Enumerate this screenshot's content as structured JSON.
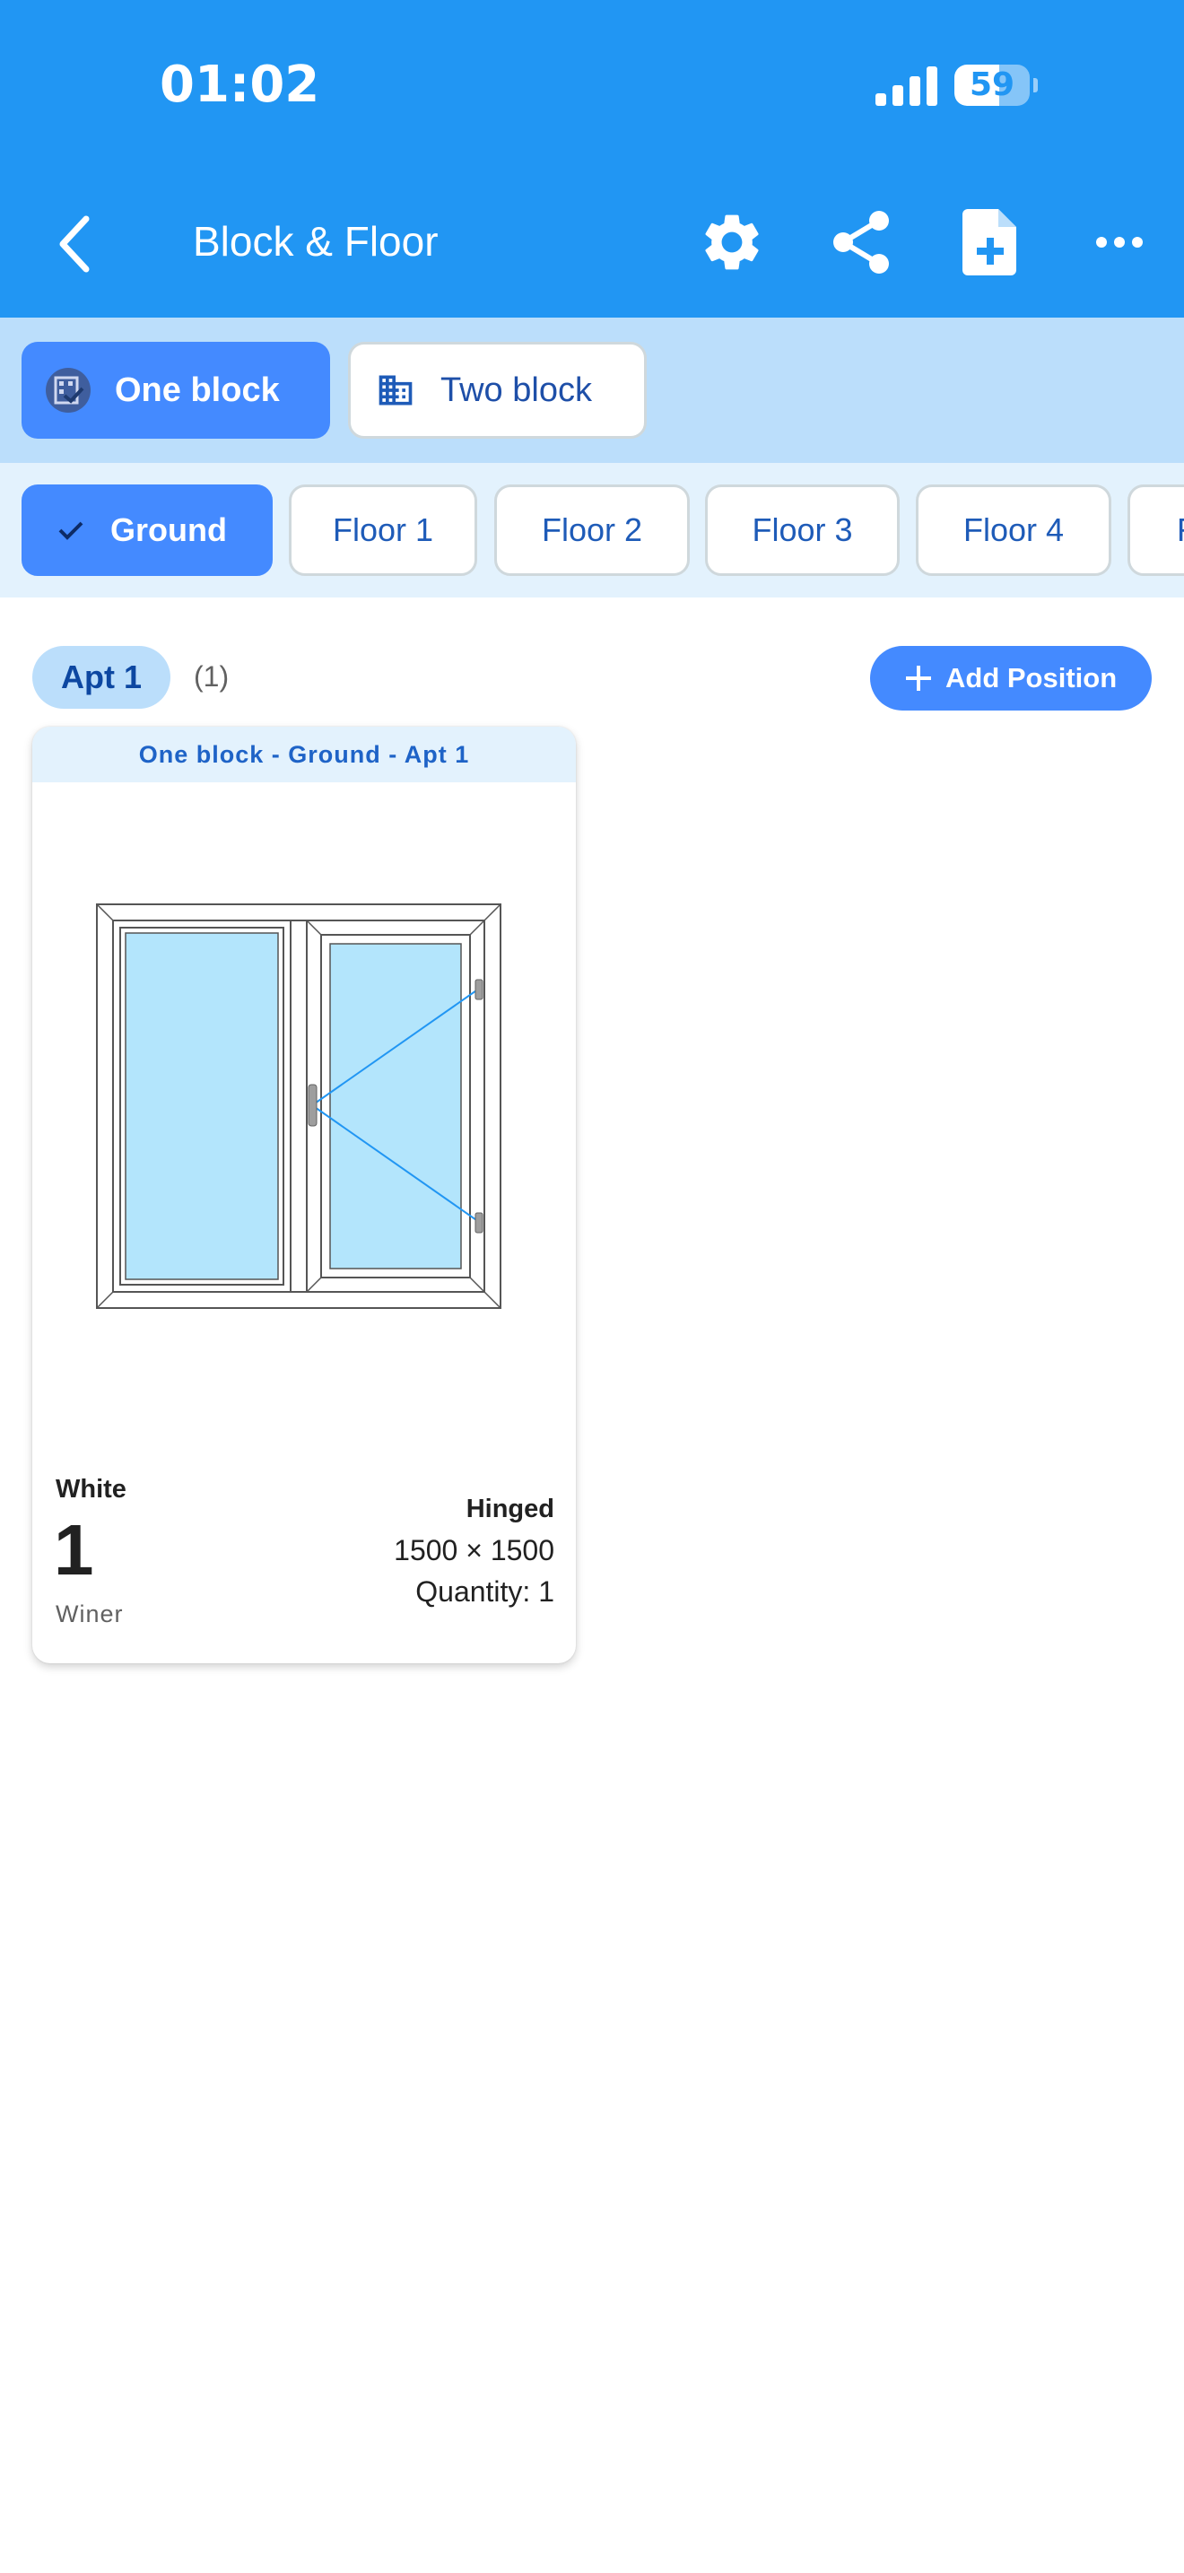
{
  "status_bar": {
    "time": "01:02",
    "battery_level": "59",
    "battery_fraction": 0.59
  },
  "app_bar": {
    "title": "Block & Floor",
    "icons": [
      "back-arrow-icon",
      "gear-icon",
      "share-icon",
      "file-add-icon",
      "more-horizontal-icon"
    ]
  },
  "blocks": [
    {
      "label": "One block",
      "selected": true
    },
    {
      "label": "Two block",
      "selected": false
    }
  ],
  "floors": [
    {
      "label": "Ground",
      "selected": true
    },
    {
      "label": "Floor 1",
      "selected": false
    },
    {
      "label": "Floor 2",
      "selected": false
    },
    {
      "label": "Floor 3",
      "selected": false
    },
    {
      "label": "Floor 4",
      "selected": false
    },
    {
      "label": "F",
      "selected": false
    }
  ],
  "apartment": {
    "label": "Apt 1",
    "count": "(1)"
  },
  "add_position_label": "Add Position",
  "card": {
    "header": "One block - Ground - Apt 1",
    "color": "White",
    "number": "1",
    "maker": "Winer",
    "type": "Hinged",
    "dimensions": "1500 × 1500",
    "quantity": "Quantity: 1"
  },
  "colors": {
    "primary": "#2196F3",
    "chip_selected": "#448AFF",
    "block_row_bg": "#BBDEFB",
    "floor_row_bg": "#E3F2FD",
    "glass": "#B3E5FC"
  }
}
